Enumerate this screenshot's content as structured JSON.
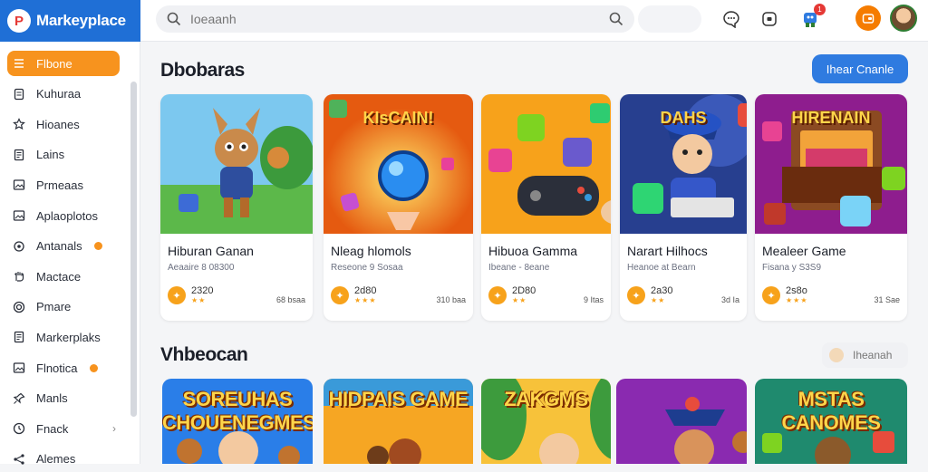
{
  "app": {
    "title": "Markeyplace",
    "logo_glyph": "P"
  },
  "search": {
    "placeholder": "Ioeaanh"
  },
  "topbar": {
    "notification_count": "1"
  },
  "sidebar": {
    "items": [
      {
        "label": "Flbone",
        "icon": "menu-icon",
        "active": true
      },
      {
        "label": "Kuhuraa",
        "icon": "file-icon"
      },
      {
        "label": "Hioanes",
        "icon": "star-icon"
      },
      {
        "label": "Lains",
        "icon": "document-icon"
      },
      {
        "label": "Prmeaas",
        "icon": "image-icon"
      },
      {
        "label": "Aplaoplotos",
        "icon": "image-icon"
      },
      {
        "label": "Antanals",
        "icon": "settings-icon",
        "badge": true
      },
      {
        "label": "Mactace",
        "icon": "hand-icon"
      },
      {
        "label": "Pmare",
        "icon": "target-icon"
      },
      {
        "label": "Markerplaks",
        "icon": "document-icon"
      },
      {
        "label": "Flnotica",
        "icon": "image-icon",
        "badge": true
      },
      {
        "label": "Manls",
        "icon": "pin-icon"
      },
      {
        "label": "Fnack",
        "icon": "clock-icon",
        "chevron": true
      },
      {
        "label": "Alemes",
        "icon": "share-icon"
      }
    ]
  },
  "section1": {
    "title": "Dbobaras",
    "cta_label": "Ihear Cnanle"
  },
  "cards": [
    {
      "name": "Hiburan Ganan",
      "sub": "Aeaaire 8 08300",
      "rating": "2320",
      "stars": "★★",
      "price": "68 bsaa",
      "art": "kangaroo",
      "img_text": ""
    },
    {
      "name": "Nleag hlomols",
      "sub": "Reseone 9 Sosaa",
      "rating": "2d80",
      "stars": "★★★",
      "price": "310 baa",
      "art": "orb",
      "img_text": "KIsCAIN!"
    },
    {
      "name": "Hibuoa Gamma",
      "sub": "Ibeane - 8eane",
      "rating": "2D80",
      "stars": "★★",
      "price": "9 Itas",
      "art": "controller",
      "img_text": ""
    },
    {
      "name": "Narart Hilhocs",
      "sub": "Heanoe at Bearn",
      "rating": "2a30",
      "stars": "★★",
      "price": "3d Ia",
      "art": "racer",
      "img_text": "DAHS"
    },
    {
      "name": "Mealeer Game",
      "sub": "Fisana y S3S9",
      "rating": "2s8o",
      "stars": "★★★",
      "price": "31 Sae",
      "art": "arcade",
      "img_text": "HIRENAIN"
    }
  ],
  "section2": {
    "title": "Vhbeocan",
    "pill_label": "Iheanah"
  },
  "cards2": [
    {
      "title": "SOREUHAS CHOUENEGMES",
      "art": "blue"
    },
    {
      "title": "HIDPAIS GAME",
      "art": "orange"
    },
    {
      "title": "ZAKGMS",
      "art": "green"
    },
    {
      "title": "",
      "art": "purple"
    },
    {
      "title": "MSTAS CANOMES",
      "art": "teal"
    }
  ],
  "colors": {
    "brand": "#1f6fd6",
    "accent": "#f7931e",
    "cta": "#2f7be0"
  }
}
